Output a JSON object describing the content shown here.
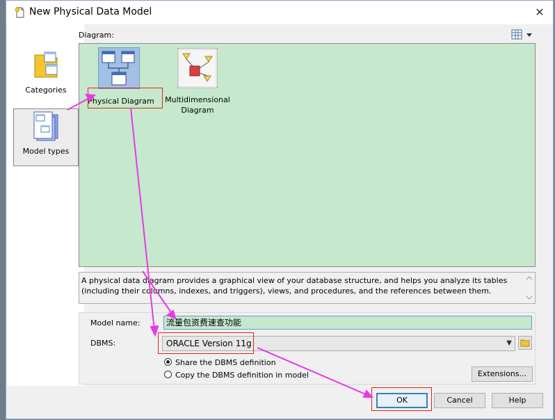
{
  "window": {
    "title": "New Physical Data Model"
  },
  "categories": [
    {
      "label": "Categories",
      "icon": "folder-forms-icon",
      "selected": false
    },
    {
      "label": "Model types",
      "icon": "model-types-icon",
      "selected": true
    }
  ],
  "diagram": {
    "label": "Diagram:",
    "items": [
      {
        "label": "Physical Diagram",
        "icon": "physical-diagram-icon",
        "selected": true
      },
      {
        "label": "Multidimensional Diagram",
        "icon": "multidimensional-diagram-icon",
        "selected": false
      }
    ]
  },
  "description": "A physical data diagram provides a graphical view of your database structure, and helps you analyze its tables (including their columns, indexes, and triggers), views, and procedures, and the references between them.",
  "form": {
    "model_name_label": "Model name:",
    "model_name_value": "流量包资费速查功能",
    "dbms_label": "DBMS:",
    "dbms_value": "ORACLE Version 11g",
    "share_option": "Share the DBMS definition",
    "copy_option": "Copy the DBMS definition in model",
    "share_selected": true,
    "extensions_label": "Extensions..."
  },
  "buttons": {
    "ok": "OK",
    "cancel": "Cancel",
    "help": "Help"
  },
  "colors": {
    "diagram_bg": "#c6e8cc",
    "annotation": "#e838e8",
    "highlight": "#e0201e"
  }
}
